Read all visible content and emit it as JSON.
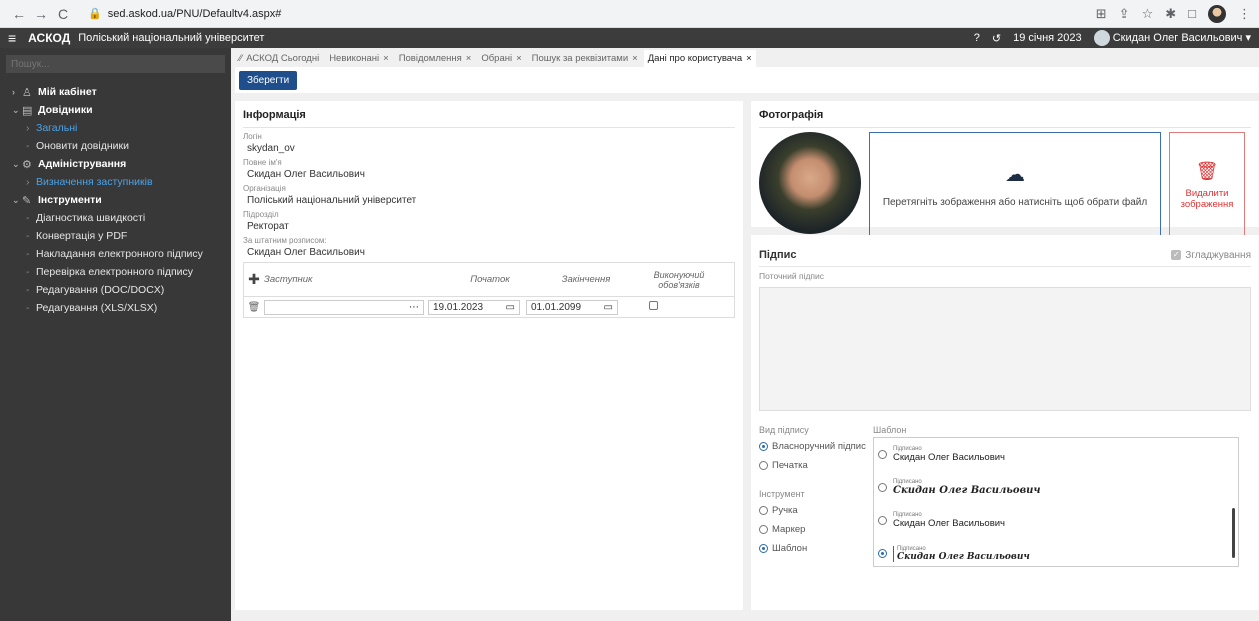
{
  "browser": {
    "url": "sed.askod.ua/PNU/Defaultv4.aspx#"
  },
  "app": {
    "brand": "АСКОД",
    "org": "Поліський національний університет",
    "date": "19 січня 2023",
    "user": "Скидан Олег Васильович"
  },
  "sidebar": {
    "search_placeholder": "Пошук...",
    "items": [
      {
        "label": "Мій кабінет"
      },
      {
        "label": "Довідники"
      },
      {
        "label": "Загальні"
      },
      {
        "label": "Оновити довідники"
      },
      {
        "label": "Адміністрування"
      },
      {
        "label": "Визначення заступників"
      },
      {
        "label": "Інструменти"
      },
      {
        "label": "Діагностика швидкості"
      },
      {
        "label": "Конвертація у PDF"
      },
      {
        "label": "Накладання електронного підпису"
      },
      {
        "label": "Перевірка електронного підпису"
      },
      {
        "label": "Редагування (DOC/DOCX)"
      },
      {
        "label": "Редагування (XLS/XLSX)"
      }
    ]
  },
  "tabs": [
    {
      "label": "АСКОД Сьогодні"
    },
    {
      "label": "Невиконані"
    },
    {
      "label": "Повідомлення"
    },
    {
      "label": "Обрані"
    },
    {
      "label": "Пошук за реквізитами"
    },
    {
      "label": "Дані про користувача"
    }
  ],
  "toolbar": {
    "save": "Зберегти"
  },
  "info": {
    "title": "Інформація",
    "login_label": "Логін",
    "login": "skydan_ov",
    "fullname_label": "Повне ім'я",
    "fullname": "Скидан Олег Васильович",
    "org_label": "Організація",
    "org": "Поліський національний університет",
    "dept_label": "Підрозділ",
    "dept": "Ректорат",
    "staff_label": "За штатним розписом:",
    "staff": "Скидан Олег Васильович",
    "deputy": {
      "col_deputy": "Заступник",
      "col_start": "Початок",
      "col_end": "Закінчення",
      "col_acting": "Виконуючий обов'язків",
      "start": "19.01.2023",
      "end": "01.01.2099"
    }
  },
  "photo": {
    "title": "Фотографія",
    "drop_text": "Перетягніть зображення або натисніть щоб обрати файл",
    "delete": "Видалити зображення"
  },
  "signature": {
    "title": "Підпис",
    "smoothing": "Згладжування",
    "current_label": "Поточний підпис",
    "type_label": "Вид підпису",
    "types": [
      "Власноручний підпис",
      "Печатка"
    ],
    "tool_label": "Інструмент",
    "tools": [
      "Ручка",
      "Маркер",
      "Шаблон"
    ],
    "template_label": "Шаблон",
    "signed": "Підписано",
    "templates": [
      "Скидан Олег Васильович",
      "Скидан Олег Васильович",
      "Скидан Олег Васильович",
      "Скидан Олег Васильович"
    ]
  }
}
